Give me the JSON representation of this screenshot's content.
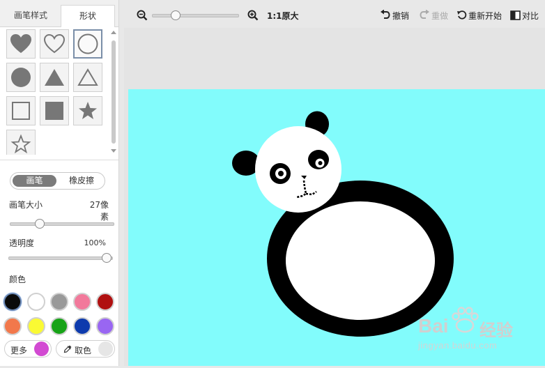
{
  "tabs": {
    "brush_style": "画笔样式",
    "shape": "形状"
  },
  "shapes": [
    {
      "name": "filled-heart-shape",
      "icon": "heart-filled"
    },
    {
      "name": "outline-heart-shape",
      "icon": "heart-outline"
    },
    {
      "name": "outline-circle-shape",
      "icon": "circle-outline",
      "selected": true
    },
    {
      "name": "filled-circle-shape",
      "icon": "circle-filled"
    },
    {
      "name": "filled-triangle-shape",
      "icon": "triangle-filled"
    },
    {
      "name": "outline-triangle-shape",
      "icon": "triangle-outline"
    },
    {
      "name": "outline-square-shape",
      "icon": "square-outline"
    },
    {
      "name": "filled-square-shape",
      "icon": "square-filled"
    },
    {
      "name": "filled-star-shape",
      "icon": "star-filled"
    },
    {
      "name": "outline-star-shape",
      "icon": "star-outline"
    }
  ],
  "mode": {
    "brush": "画笔",
    "eraser": "橡皮擦",
    "active": "brush"
  },
  "brush_size": {
    "label": "画笔大小",
    "value": "27像素",
    "fraction": 0.27
  },
  "opacity": {
    "label": "透明度",
    "value": "100%",
    "fraction": 1.0
  },
  "colors": {
    "label": "颜色",
    "swatches": [
      "#0a0a0a",
      "#ffffff",
      "#999999",
      "#f2799b",
      "#b01010",
      "#f2784b",
      "#fafa33",
      "#17a317",
      "#0d3aad",
      "#9966f2"
    ],
    "selected": "#0a0a0a",
    "more_label": "更多",
    "more_color": "#d24ad2",
    "picker_label": "取色",
    "picker_color": "#e6e6e6"
  },
  "toolbar": {
    "zoom_label": "1:1原大",
    "zoom_level": 0.25,
    "undo": "撤销",
    "redo": "重做",
    "restart": "重新开始",
    "compare": "对比"
  },
  "canvas": {
    "background": "#82fcfc"
  },
  "watermark": {
    "brand": "Bai",
    "brand2": "经验",
    "url": "jingyan.baidu.com"
  }
}
